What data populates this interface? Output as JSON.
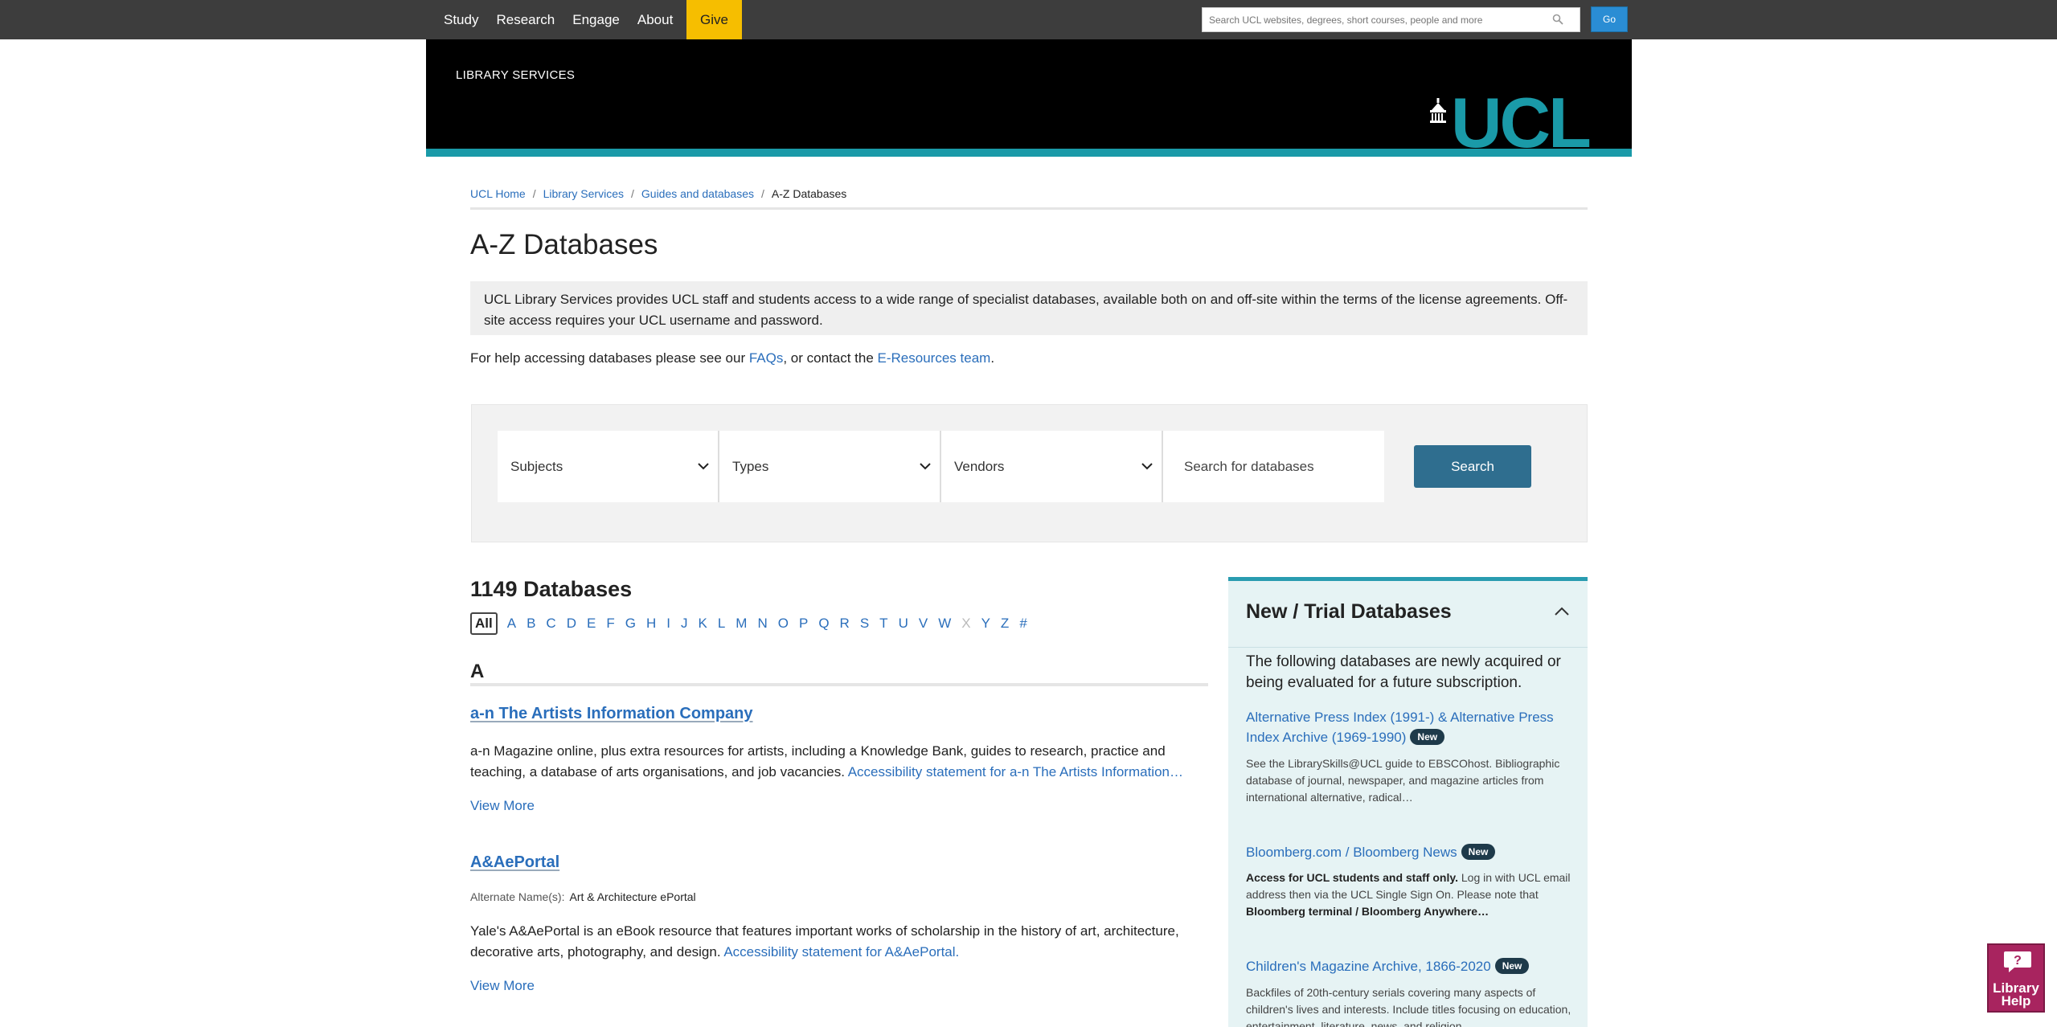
{
  "topnav": {
    "links": [
      "Study",
      "Research",
      "Engage",
      "About"
    ],
    "give": "Give",
    "search_placeholder": "Search UCL websites, degrees, short courses, people and more",
    "go": "Go"
  },
  "banner": {
    "title": "LIBRARY SERVICES",
    "logo_text": "UCL"
  },
  "breadcrumb": {
    "items": [
      "UCL Home",
      "Library Services",
      "Guides and databases"
    ],
    "current": "A-Z Databases"
  },
  "page_title": "A-Z Databases",
  "intro": "UCL Library Services provides UCL staff and students access to a wide range of specialist databases, available both on and off-site within the terms of the license agreements. Off-site access requires your UCL username and password.",
  "help": {
    "prefix": "For help accessing databases please see our ",
    "faqs": "FAQs",
    "middle": ", or contact the ",
    "eresources": "E-Resources team",
    "suffix": "."
  },
  "filters": {
    "subjects": "Subjects",
    "types": "Types",
    "vendors": "Vendors",
    "search_placeholder": "Search for databases",
    "search_button": "Search"
  },
  "results": {
    "count": "1149 Databases",
    "alphabet": [
      "All",
      "A",
      "B",
      "C",
      "D",
      "E",
      "F",
      "G",
      "H",
      "I",
      "J",
      "K",
      "L",
      "M",
      "N",
      "O",
      "P",
      "Q",
      "R",
      "S",
      "T",
      "U",
      "V",
      "W",
      "X",
      "Y",
      "Z",
      "#"
    ],
    "alphabet_disabled": [
      "X"
    ],
    "letter": "A",
    "entries": [
      {
        "title": "a-n The Artists Information Company",
        "desc": "a-n Magazine online, plus extra resources for artists, including a Knowledge Bank, guides to research, practice and teaching, a database of arts organisations, and job vacancies. ",
        "link": "Accessibility statement for a-n The Artists Information…",
        "more": "View More"
      },
      {
        "title": "A&AePortal",
        "alt_label": "Alternate Name(s):",
        "alt_value": "Art & Architecture ePortal",
        "desc": "Yale's A&AePortal is an eBook resource that features important works of scholarship in the history of art, architecture, decorative arts, photography, and design. ",
        "link": "Accessibility statement for A&AePortal.",
        "more": "View More"
      }
    ]
  },
  "side": {
    "heading": "New / Trial Databases",
    "lead": "The following databases are newly acquired or being evaluated for a future subscription.",
    "badge": "New",
    "items": [
      {
        "title": "Alternative Press Index (1991-) & Alternative Press Index Archive (1969-1990)",
        "desc": "See the LibrarySkills@UCL guide to EBSCOhost. Bibliographic database of journal, newspaper, and magazine articles from international alternative, radical…"
      },
      {
        "title": "Bloomberg.com / Bloomberg News",
        "desc_bold1": "Access for UCL students and staff only.",
        "desc_mid": " Log in with UCL email address then via the UCL Single Sign On. Please note that ",
        "desc_bold2": "Bloomberg terminal / Bloomberg Anywhere…"
      },
      {
        "title": "Children's Magazine Archive, 1866-2020",
        "desc": "Backfiles of 20th-century serials covering many aspects of children's lives and interests. Include titles focusing on education, entertainment, literature, news, and religion ..."
      }
    ]
  },
  "library_help": {
    "line1": "Library",
    "line2": "Help"
  }
}
